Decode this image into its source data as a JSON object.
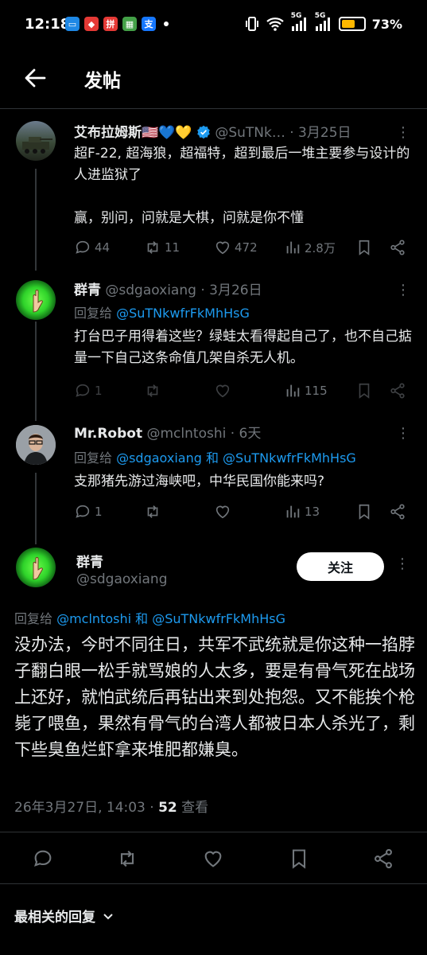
{
  "status_bar": {
    "time": "12:18",
    "apps": [
      {
        "name": "app-1",
        "color": "#1e88e5",
        "glyph": "▭"
      },
      {
        "name": "app-2",
        "color": "#e53935",
        "glyph": "◆"
      },
      {
        "name": "app-3",
        "color": "#e53935",
        "glyph": "拼"
      },
      {
        "name": "app-4",
        "color": "#43a047",
        "glyph": "▦"
      },
      {
        "name": "app-5",
        "color": "#1677ff",
        "glyph": "支"
      }
    ],
    "signal_1": "5G",
    "signal_2": "5G",
    "battery": "73%",
    "battery_level": 0.73
  },
  "header": {
    "title": "发帖"
  },
  "tweets": [
    {
      "name": "艾布拉姆斯🇺🇸💙💛",
      "handle": "@SuTNk…",
      "time": "· 3月25日",
      "verified": true,
      "text": "超F-22, 超海狼，超福特，超到最后一堆主要参与设计的人进监狱了\n\n赢，别问，问就是大棋，问就是你不懂",
      "replies": "44",
      "retweets": "11",
      "likes": "472",
      "views": "2.8万"
    },
    {
      "name": "群青",
      "handle": "@sdgaoxiang",
      "time": "· 3月26日",
      "reply_prefix": "回复给 ",
      "reply_targets": "@SuTNkwfrFkMhHsG",
      "text": "打台巴子用得着这些？绿蛙太看得起自己了，也不自己掂量一下自己这条命值几架自杀无人机。",
      "replies": "1",
      "retweets": "",
      "likes": "",
      "views": "115"
    },
    {
      "name": "Mr.Robot",
      "handle": "@mclntoshi",
      "time": "· 6天",
      "reply_prefix": "回复给 ",
      "reply_targets": "@sdgaoxiang 和 @SuTNkwfrFkMhHsG",
      "text": "支那猪先游过海峡吧，中华民国你能来吗?",
      "replies": "1",
      "retweets": "",
      "likes": "",
      "views": "13"
    }
  ],
  "focused": {
    "name": "群青",
    "handle": "@sdgaoxiang",
    "follow_label": "关注",
    "reply_prefix": "回复给 ",
    "reply_targets": "@mclntoshi 和 @SuTNkwfrFkMhHsG",
    "text": "没办法，今时不同往日，共军不武统就是你这种一掐脖子翻白眼一松手就骂娘的人太多，要是有骨气死在战场上还好，就怕武统后再钻出来到处抱怨。又不能挨个枪毙了喂鱼，果然有骨气的台湾人都被日本人杀光了，剩下些臭鱼烂虾拿来堆肥都嫌臭。",
    "datetime": "26年3月27日, 14:03 · ",
    "views_count": "52",
    "views_label": " 查看"
  },
  "sort": {
    "label": "最相关的回复"
  },
  "colors": {
    "accent": "#1d9bf0",
    "muted": "#71767b",
    "background": "#000000",
    "verified": "#1d9bf0"
  }
}
